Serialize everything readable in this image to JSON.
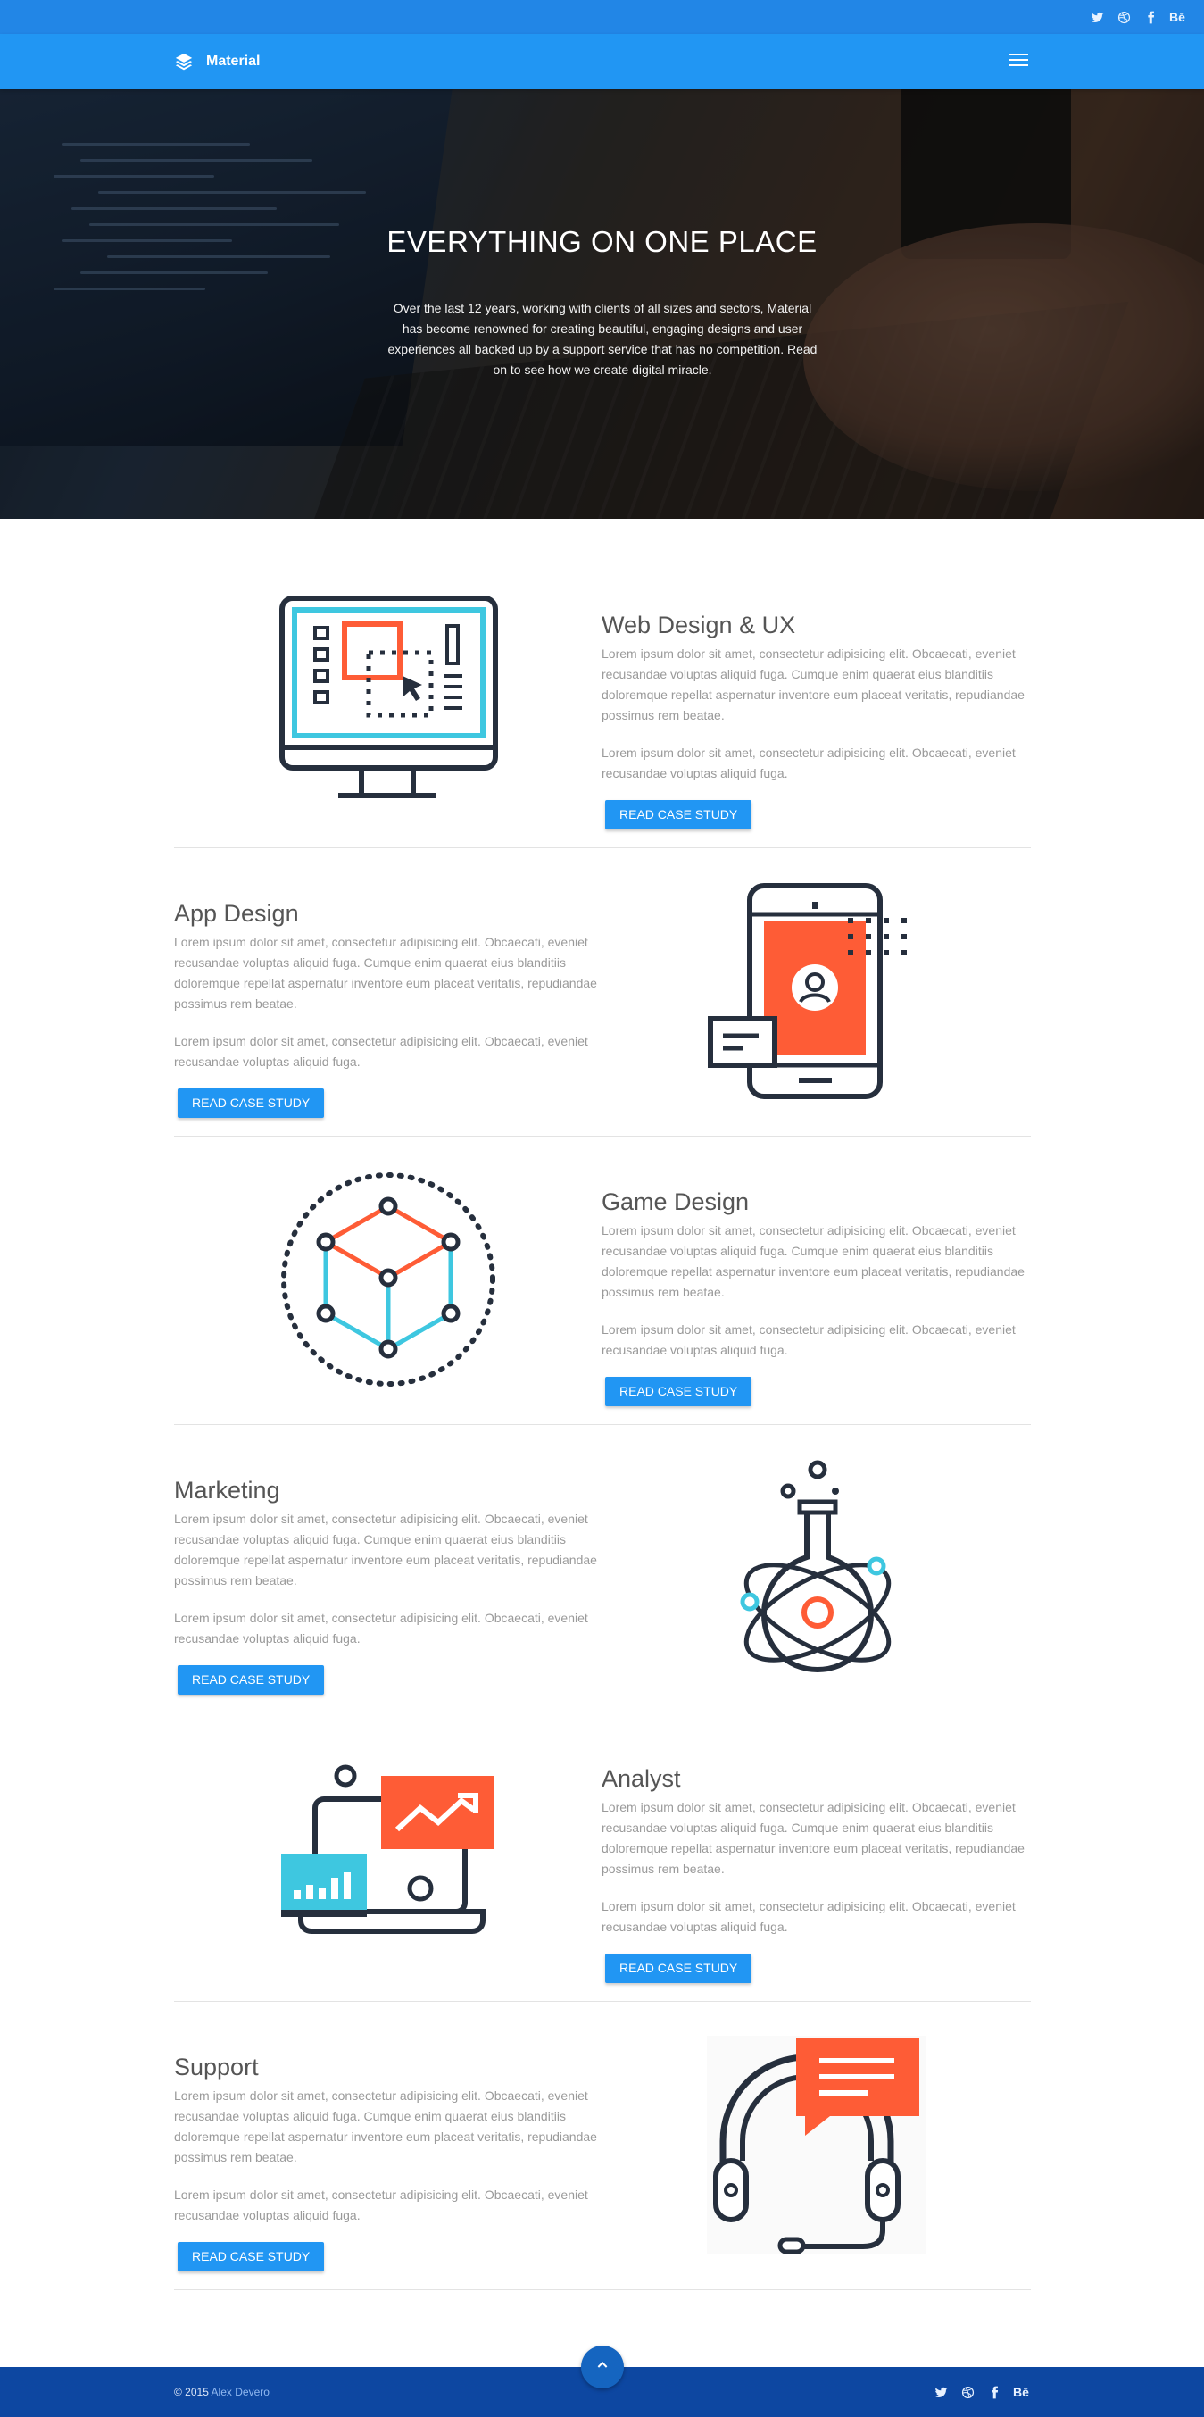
{
  "header": {
    "brand": "Material",
    "social": [
      {
        "icon": "twitter-icon"
      },
      {
        "icon": "dribbble-icon"
      },
      {
        "icon": "facebook-icon"
      },
      {
        "icon": "behance-icon",
        "label": "Bē"
      }
    ]
  },
  "hero": {
    "title": "EVERYTHING ON ONE PLACE",
    "text": "Over the last 12 years, working with clients of all sizes and sectors, Material has become renowned for creating beautiful, engaging designs and user experiences all backed up by a support service that has no competition. Read on to see how we create digital miracle."
  },
  "services": [
    {
      "title": "Web Design & UX",
      "p1": "Lorem ipsum dolor sit amet, consectetur adipisicing elit. Obcaecati, eveniet recusandae voluptas aliquid fuga. Cumque enim quaerat eius blanditiis doloremque repellat aspernatur inventore eum placeat veritatis, repudiandae possimus rem beatae.",
      "p2": "Lorem ipsum dolor sit amet, consectetur adipisicing elit. Obcaecati, eveniet recusandae voluptas aliquid fuga.",
      "button": "READ CASE STUDY",
      "icon": "monitor-design-icon"
    },
    {
      "title": "App Design",
      "p1": "Lorem ipsum dolor sit amet, consectetur adipisicing elit. Obcaecati, eveniet recusandae voluptas aliquid fuga. Cumque enim quaerat eius blanditiis doloremque repellat aspernatur inventore eum placeat veritatis, repudiandae possimus rem beatae.",
      "p2": "Lorem ipsum dolor sit amet, consectetur adipisicing elit. Obcaecati, eveniet recusandae voluptas aliquid fuga.",
      "button": "READ CASE STUDY",
      "icon": "smartphone-user-icon"
    },
    {
      "title": "Game Design",
      "p1": "Lorem ipsum dolor sit amet, consectetur adipisicing elit. Obcaecati, eveniet recusandae voluptas aliquid fuga. Cumque enim quaerat eius blanditiis doloremque repellat aspernatur inventore eum placeat veritatis, repudiandae possimus rem beatae.",
      "p2": "Lorem ipsum dolor sit amet, consectetur adipisicing elit. Obcaecati, eveniet recusandae voluptas aliquid fuga.",
      "button": "READ CASE STUDY",
      "icon": "cube-network-icon"
    },
    {
      "title": "Marketing",
      "p1": "Lorem ipsum dolor sit amet, consectetur adipisicing elit. Obcaecati, eveniet recusandae voluptas aliquid fuga. Cumque enim quaerat eius blanditiis doloremque repellat aspernatur inventore eum placeat veritatis, repudiandae possimus rem beatae.",
      "p2": "Lorem ipsum dolor sit amet, consectetur adipisicing elit. Obcaecati, eveniet recusandae voluptas aliquid fuga.",
      "button": "READ CASE STUDY",
      "icon": "science-flask-icon"
    },
    {
      "title": "Analyst",
      "p1": "Lorem ipsum dolor sit amet, consectetur adipisicing elit. Obcaecati, eveniet recusandae voluptas aliquid fuga. Cumque enim quaerat eius blanditiis doloremque repellat aspernatur inventore eum placeat veritatis, repudiandae possimus rem beatae.",
      "p2": "Lorem ipsum dolor sit amet, consectetur adipisicing elit. Obcaecati, eveniet recusandae voluptas aliquid fuga.",
      "button": "READ CASE STUDY",
      "icon": "laptop-analytics-icon"
    },
    {
      "title": "Support",
      "p1": "Lorem ipsum dolor sit amet, consectetur adipisicing elit. Obcaecati, eveniet recusandae voluptas aliquid fuga. Cumque enim quaerat eius blanditiis doloremque repellat aspernatur inventore eum placeat veritatis, repudiandae possimus rem beatae.",
      "p2": "Lorem ipsum dolor sit amet, consectetur adipisicing elit. Obcaecati, eveniet recusandae voluptas aliquid fuga.",
      "button": "READ CASE STUDY",
      "icon": "headset-support-icon"
    }
  ],
  "footer": {
    "copyright": "© 2015",
    "author": "Alex Devero",
    "back_to_top_icon": "chevron-up-icon"
  },
  "colors": {
    "topbar": "#2286e6",
    "navbar": "#2196f3",
    "button": "#2196f3",
    "footer": "#0d47a1",
    "accent_orange": "#fe5c36",
    "accent_cyan": "#3ec7e0",
    "icon_stroke": "#262f3d"
  }
}
